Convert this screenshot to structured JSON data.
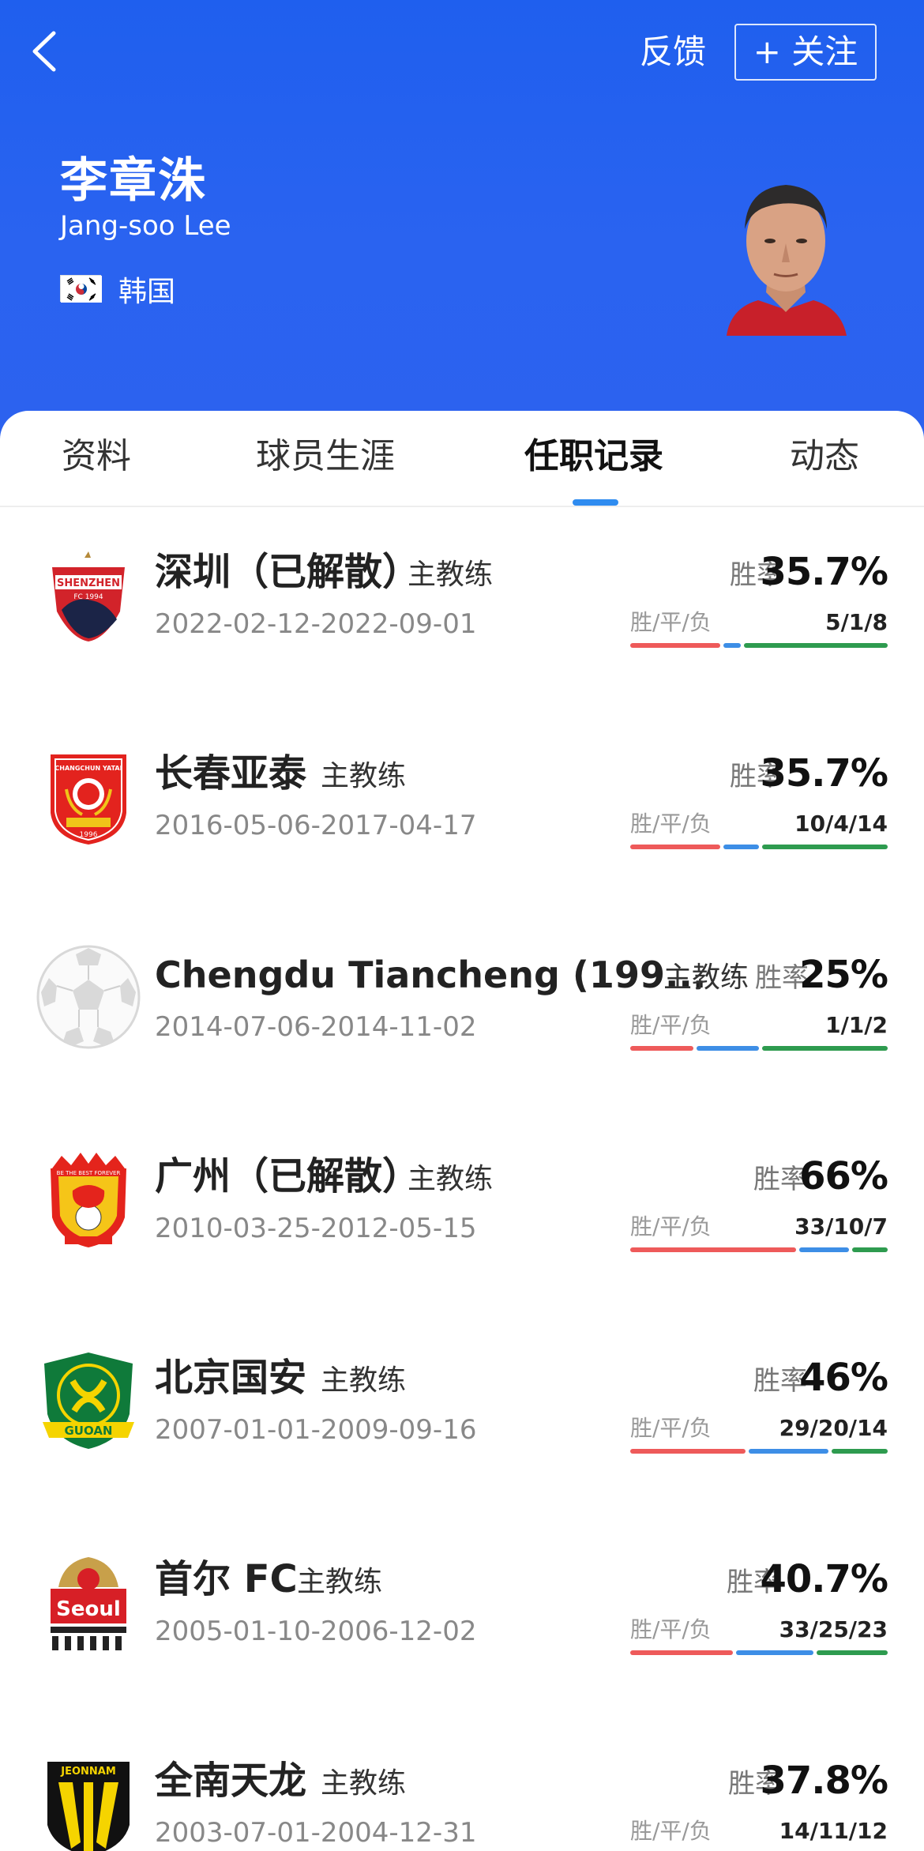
{
  "header": {
    "feedback_label": "反馈",
    "follow_label": "+ 关注",
    "coach_name": "李章洙",
    "coach_name_en": "Jang-soo Lee",
    "country": "韩国",
    "background_color": "#2a63f0"
  },
  "tabs": [
    {
      "label": "资料",
      "active": false
    },
    {
      "label": "球员生涯",
      "active": false
    },
    {
      "label": "任职记录",
      "active": true
    },
    {
      "label": "动态",
      "active": false
    }
  ],
  "stats_labels": {
    "win_rate": "胜率",
    "wdl": "胜/平/负"
  },
  "colors": {
    "win": "#ee5a5a",
    "draw": "#3d8ee6",
    "loss": "#2e9b4f",
    "accent": "#2f8cf0"
  },
  "records": [
    {
      "team": "深圳（已解散）",
      "role": "主教练",
      "dates": "2022-02-12-2022-09-01",
      "win_rate": "35.7%",
      "wdl": "5/1/8",
      "wins": 5,
      "draws": 1,
      "losses": 8,
      "logo_icon": "shenzhen-fc-logo"
    },
    {
      "team": "长春亚泰",
      "role": "主教练",
      "dates": "2016-05-06-2017-04-17",
      "win_rate": "35.7%",
      "wdl": "10/4/14",
      "wins": 10,
      "draws": 4,
      "losses": 14,
      "logo_icon": "changchun-yatai-logo"
    },
    {
      "team": "Chengdu Tiancheng (199...",
      "role": "主教练",
      "dates": "2014-07-06-2014-11-02",
      "win_rate": "25%",
      "wdl": "1/1/2",
      "wins": 1,
      "draws": 1,
      "losses": 2,
      "logo_icon": "soccer-ball-icon"
    },
    {
      "team": "广州（已解散）",
      "role": "主教练",
      "dates": "2010-03-25-2012-05-15",
      "win_rate": "66%",
      "wdl": "33/10/7",
      "wins": 33,
      "draws": 10,
      "losses": 7,
      "logo_icon": "guangzhou-fc-logo"
    },
    {
      "team": "北京国安",
      "role": "主教练",
      "dates": "2007-01-01-2009-09-16",
      "win_rate": "46%",
      "wdl": "29/20/14",
      "wins": 29,
      "draws": 20,
      "losses": 14,
      "logo_icon": "beijing-guoan-logo"
    },
    {
      "team": "首尔 FC",
      "role": "主教练",
      "dates": "2005-01-10-2006-12-02",
      "win_rate": "40.7%",
      "wdl": "33/25/23",
      "wins": 33,
      "draws": 25,
      "losses": 23,
      "logo_icon": "fc-seoul-logo"
    },
    {
      "team": "全南天龙",
      "role": "主教练",
      "dates": "2003-07-01-2004-12-31",
      "win_rate": "37.8%",
      "wdl": "14/11/12",
      "wins": 14,
      "draws": 11,
      "losses": 12,
      "logo_icon": "jeonnam-dragons-logo"
    }
  ]
}
